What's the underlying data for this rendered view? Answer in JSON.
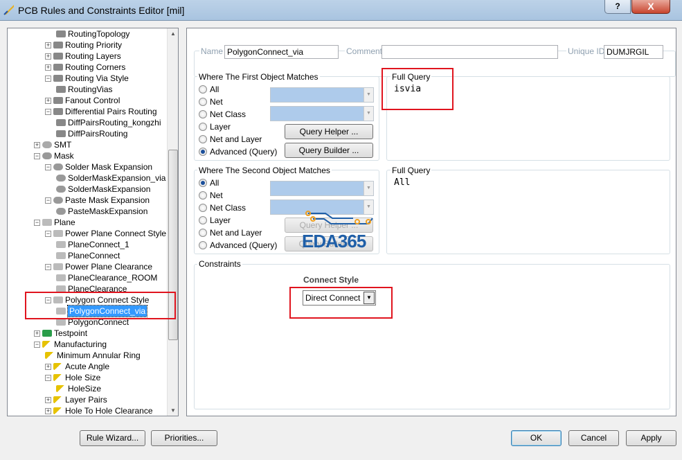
{
  "window": {
    "title": "PCB Rules and Constraints Editor [mil]",
    "help": "?",
    "close": "X"
  },
  "tree": [
    {
      "label": "RoutingTopology",
      "depth": 3,
      "exp": "",
      "icon": "routing"
    },
    {
      "label": "Routing Priority",
      "depth": 2,
      "exp": "+",
      "icon": "routing"
    },
    {
      "label": "Routing Layers",
      "depth": 2,
      "exp": "+",
      "icon": "routing"
    },
    {
      "label": "Routing Corners",
      "depth": 2,
      "exp": "+",
      "icon": "routing"
    },
    {
      "label": "Routing Via Style",
      "depth": 2,
      "exp": "-",
      "icon": "routing"
    },
    {
      "label": "RoutingVias",
      "depth": 3,
      "exp": "",
      "icon": "routing"
    },
    {
      "label": "Fanout Control",
      "depth": 2,
      "exp": "+",
      "icon": "routing"
    },
    {
      "label": "Differential Pairs Routing",
      "depth": 2,
      "exp": "-",
      "icon": "routing"
    },
    {
      "label": "DiffPairsRouting_kongzhi",
      "depth": 3,
      "exp": "",
      "icon": "routing"
    },
    {
      "label": "DiffPairsRouting",
      "depth": 3,
      "exp": "",
      "icon": "routing"
    },
    {
      "label": "SMT",
      "depth": 1,
      "exp": "+",
      "icon": "smt"
    },
    {
      "label": "Mask",
      "depth": 1,
      "exp": "-",
      "icon": "mask"
    },
    {
      "label": "Solder Mask Expansion",
      "depth": 2,
      "exp": "-",
      "icon": "mask"
    },
    {
      "label": "SolderMaskExpansion_via",
      "depth": 3,
      "exp": "",
      "icon": "mask"
    },
    {
      "label": "SolderMaskExpansion",
      "depth": 3,
      "exp": "",
      "icon": "mask"
    },
    {
      "label": "Paste Mask Expansion",
      "depth": 2,
      "exp": "-",
      "icon": "mask"
    },
    {
      "label": "PasteMaskExpansion",
      "depth": 3,
      "exp": "",
      "icon": "mask"
    },
    {
      "label": "Plane",
      "depth": 1,
      "exp": "-",
      "icon": "plane"
    },
    {
      "label": "Power Plane Connect Style",
      "depth": 2,
      "exp": "-",
      "icon": "plane"
    },
    {
      "label": "PlaneConnect_1",
      "depth": 3,
      "exp": "",
      "icon": "plane"
    },
    {
      "label": "PlaneConnect",
      "depth": 3,
      "exp": "",
      "icon": "plane"
    },
    {
      "label": "Power Plane Clearance",
      "depth": 2,
      "exp": "-",
      "icon": "plane"
    },
    {
      "label": "PlaneClearance_ROOM",
      "depth": 3,
      "exp": "",
      "icon": "plane"
    },
    {
      "label": "PlaneClearance",
      "depth": 3,
      "exp": "",
      "icon": "plane"
    },
    {
      "label": "Polygon Connect Style",
      "depth": 2,
      "exp": "-",
      "icon": "plane"
    },
    {
      "label": "PolygonConnect_via",
      "depth": 3,
      "exp": "",
      "icon": "plane",
      "selected": true
    },
    {
      "label": "PolygonConnect",
      "depth": 3,
      "exp": "",
      "icon": "plane"
    },
    {
      "label": "Testpoint",
      "depth": 1,
      "exp": "+",
      "icon": "testpoint"
    },
    {
      "label": "Manufacturing",
      "depth": 1,
      "exp": "-",
      "icon": "mfg"
    },
    {
      "label": "Minimum Annular Ring",
      "depth": 2,
      "exp": "",
      "icon": "mfg"
    },
    {
      "label": "Acute Angle",
      "depth": 2,
      "exp": "+",
      "icon": "mfg"
    },
    {
      "label": "Hole Size",
      "depth": 2,
      "exp": "-",
      "icon": "mfg"
    },
    {
      "label": "HoleSize",
      "depth": 3,
      "exp": "",
      "icon": "mfg"
    },
    {
      "label": "Layer Pairs",
      "depth": 2,
      "exp": "+",
      "icon": "mfg"
    },
    {
      "label": "Hole To Hole Clearance",
      "depth": 2,
      "exp": "+",
      "icon": "mfg"
    }
  ],
  "rule": {
    "name_label": "Name",
    "name": "PolygonConnect_via",
    "comment_label": "Comment",
    "comment": "",
    "uid_label": "Unique ID",
    "uid": "DUMJRGIL"
  },
  "first": {
    "title": "Where The First Object Matches",
    "options": [
      "All",
      "Net",
      "Net Class",
      "Layer",
      "Net and Layer",
      "Advanced (Query)"
    ],
    "selected": 5,
    "helper": "Query Helper ...",
    "builder": "Query Builder ...",
    "fq_label": "Full Query",
    "query": "isvia"
  },
  "second": {
    "title": "Where The Second Object Matches",
    "options": [
      "All",
      "Net",
      "Net Class",
      "Layer",
      "Net and Layer",
      "Advanced (Query)"
    ],
    "selected": 0,
    "helper": "Query Helper ...",
    "builder": "Query Builder ...",
    "fq_label": "Full Query",
    "query": "All"
  },
  "constraints": {
    "title": "Constraints",
    "connect_style_label": "Connect Style",
    "connect_style": "Direct Connect"
  },
  "watermark": "EDA365",
  "buttons": {
    "wizard": "Rule Wizard...",
    "priorities": "Priorities...",
    "ok": "OK",
    "cancel": "Cancel",
    "apply": "Apply"
  }
}
